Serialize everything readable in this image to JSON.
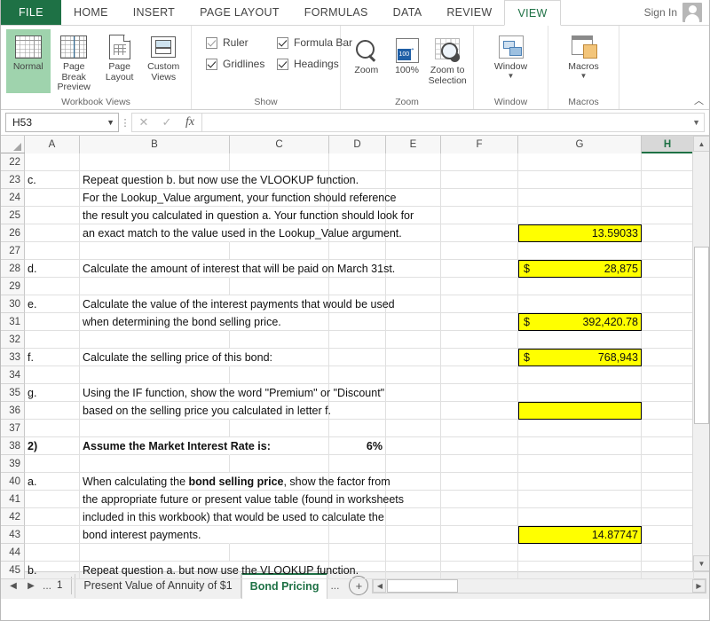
{
  "window": {
    "account": "Sign In",
    "avatar_icon": "user-avatar-icon"
  },
  "ribbon_tabs": [
    {
      "label": "FILE",
      "active": false,
      "file": true
    },
    {
      "label": "HOME",
      "active": false
    },
    {
      "label": "INSERT",
      "active": false
    },
    {
      "label": "PAGE LAYOUT",
      "active": false
    },
    {
      "label": "FORMULAS",
      "active": false
    },
    {
      "label": "DATA",
      "active": false
    },
    {
      "label": "REVIEW",
      "active": false
    },
    {
      "label": "VIEW",
      "active": true
    }
  ],
  "ribbon": {
    "groups": [
      {
        "label": "Workbook Views",
        "buttons": [
          {
            "label_line1": "Normal",
            "label_line2": "",
            "icon": "normal-view-icon",
            "selected": true
          },
          {
            "label_line1": "Page Break",
            "label_line2": "Preview",
            "icon": "page-break-preview-icon",
            "selected": false
          },
          {
            "label_line1": "Page",
            "label_line2": "Layout",
            "icon": "page-layout-icon",
            "selected": false
          },
          {
            "label_line1": "Custom",
            "label_line2": "Views",
            "icon": "custom-views-icon",
            "selected": false
          }
        ]
      },
      {
        "label": "Show",
        "checkboxes": [
          {
            "label": "Ruler",
            "checked": true,
            "dim": true
          },
          {
            "label": "Formula Bar",
            "checked": true,
            "dim": false
          },
          {
            "label": "Gridlines",
            "checked": true,
            "dim": false
          },
          {
            "label": "Headings",
            "checked": true,
            "dim": false
          }
        ]
      },
      {
        "label": "Zoom",
        "buttons": [
          {
            "label_line1": "Zoom",
            "label_line2": "",
            "icon": "magnifier-icon"
          },
          {
            "label_line1": "100%",
            "label_line2": "",
            "icon": "zoom-100-icon"
          },
          {
            "label_line1": "Zoom to",
            "label_line2": "Selection",
            "icon": "zoom-to-selection-icon"
          }
        ]
      },
      {
        "label": "Window",
        "buttons": [
          {
            "label_line1": "Window",
            "label_line2": "",
            "icon": "window-icon",
            "dropdown": true
          }
        ]
      },
      {
        "label": "Macros",
        "buttons": [
          {
            "label_line1": "Macros",
            "label_line2": "",
            "icon": "macros-icon",
            "dropdown": true
          }
        ]
      }
    ],
    "collapse_icon": "collapse-ribbon-icon"
  },
  "formula_bar": {
    "name_box_value": "H53",
    "cancel_icon": "cancel-icon",
    "enter_icon": "confirm-icon",
    "function_icon": "fx-icon",
    "formula_value": "",
    "expand_icon": "expand-formula-bar-icon"
  },
  "grid": {
    "columns": [
      {
        "label": "A",
        "width": 62,
        "selected": false
      },
      {
        "label": "B",
        "width": 169,
        "selected": false
      },
      {
        "label": "C",
        "width": 112,
        "selected": false
      },
      {
        "label": "D",
        "width": 64,
        "selected": false
      },
      {
        "label": "E",
        "width": 62,
        "selected": false
      },
      {
        "label": "F",
        "width": 87,
        "selected": false
      },
      {
        "label": "G",
        "width": 139,
        "selected": false
      },
      {
        "label": "H",
        "width": 59,
        "selected": true
      }
    ],
    "active_cell": "H53",
    "rows": [
      {
        "num": "22",
        "cells": []
      },
      {
        "num": "23",
        "cells": [
          {
            "col": 0,
            "text": "c."
          },
          {
            "col": 1,
            "text": "Repeat question b. but now use the VLOOKUP function.",
            "spill": true
          }
        ]
      },
      {
        "num": "24",
        "cells": [
          {
            "col": 1,
            "text": "For the Lookup_Value argument, your function should reference",
            "spill": true
          }
        ]
      },
      {
        "num": "25",
        "cells": [
          {
            "col": 1,
            "text": "the result you calculated in question a.   Your function should look for",
            "spill": true
          }
        ]
      },
      {
        "num": "26",
        "cells": [
          {
            "col": 1,
            "text": "an exact match to the value used in the Lookup_Value argument.",
            "spill": true
          },
          {
            "col": 6,
            "text": "13.59033",
            "highlight": true,
            "align": "right"
          }
        ]
      },
      {
        "num": "27",
        "cells": []
      },
      {
        "num": "28",
        "cells": [
          {
            "col": 0,
            "text": "d."
          },
          {
            "col": 1,
            "text": "Calculate the amount of interest that will be paid on March 31st.",
            "spill": true
          },
          {
            "col": 6,
            "text": "28,875",
            "prefix": "$",
            "highlight": true,
            "align": "right"
          }
        ]
      },
      {
        "num": "29",
        "cells": []
      },
      {
        "num": "30",
        "cells": [
          {
            "col": 0,
            "text": "e."
          },
          {
            "col": 1,
            "text": "Calculate the value of the interest payments that would be used",
            "spill": true
          }
        ]
      },
      {
        "num": "31",
        "cells": [
          {
            "col": 1,
            "text": "when determining the bond selling price.",
            "spill": true
          },
          {
            "col": 6,
            "text": "392,420.78",
            "prefix": "$",
            "highlight": true,
            "align": "right"
          }
        ]
      },
      {
        "num": "32",
        "cells": []
      },
      {
        "num": "33",
        "cells": [
          {
            "col": 0,
            "text": "f."
          },
          {
            "col": 1,
            "text": "Calculate the selling price of this bond:",
            "spill": true
          },
          {
            "col": 6,
            "text": "768,943",
            "prefix": "$",
            "highlight": true,
            "align": "right"
          }
        ]
      },
      {
        "num": "34",
        "cells": []
      },
      {
        "num": "35",
        "cells": [
          {
            "col": 0,
            "text": "g."
          },
          {
            "col": 1,
            "text": "Using the IF function, show the word \"Premium\" or \"Discount\"",
            "spill": true
          }
        ]
      },
      {
        "num": "36",
        "cells": [
          {
            "col": 1,
            "text": "based on the selling price you calculated in letter f.",
            "spill": true
          },
          {
            "col": 6,
            "text": "",
            "highlight": true,
            "align": "right"
          }
        ]
      },
      {
        "num": "37",
        "cells": []
      },
      {
        "num": "38",
        "cells": [
          {
            "col": 0,
            "text": "2)",
            "bold": true
          },
          {
            "col": 1,
            "text": "Assume the Market Interest Rate is:",
            "bold": true,
            "spill": true
          },
          {
            "col": 3,
            "text": "6%",
            "bold": true,
            "align": "right"
          }
        ]
      },
      {
        "num": "39",
        "cells": []
      },
      {
        "num": "40",
        "cells": [
          {
            "col": 0,
            "text": "a."
          },
          {
            "col": 1,
            "text": "When calculating the bond selling price, show the factor from",
            "spill": true,
            "rich": [
              {
                "t": "When calculating the ",
                "b": false
              },
              {
                "t": "bond selling price",
                "b": true
              },
              {
                "t": ", show the factor from",
                "b": false
              }
            ]
          }
        ]
      },
      {
        "num": "41",
        "cells": [
          {
            "col": 1,
            "text": "the appropriate future or present value table (found in worksheets",
            "spill": true
          }
        ]
      },
      {
        "num": "42",
        "cells": [
          {
            "col": 1,
            "text": "included in this workbook)  that would be used to calculate the",
            "spill": true
          }
        ]
      },
      {
        "num": "43",
        "cells": [
          {
            "col": 1,
            "text": "bond interest payments.",
            "spill": true
          },
          {
            "col": 6,
            "text": "14.87747",
            "highlight": true,
            "align": "right"
          }
        ]
      },
      {
        "num": "44",
        "cells": []
      },
      {
        "num": "45",
        "cells": [
          {
            "col": 0,
            "text": "b."
          },
          {
            "col": 1,
            "text": "Repeat question a. but now use the VLOOKUP function.",
            "spill": true
          }
        ]
      }
    ]
  },
  "sheet_bar": {
    "first_icon": "nav-first-sheet-icon",
    "prev_icon": "nav-previous-sheet-icon",
    "ellipsis_left": "...",
    "hidden_count": "1",
    "tabs": [
      {
        "label": "Present Value of Annuity of $1",
        "active": false
      },
      {
        "label": "Bond Pricing",
        "active": true
      }
    ],
    "ellipsis_right": "...",
    "add_sheet_icon": "add-sheet-icon",
    "hscroll_left_icon": "hscroll-left-icon",
    "hscroll_right_icon": "hscroll-right-icon"
  },
  "colors": {
    "brand_green": "#1e7145",
    "highlight_yellow": "#ffff00",
    "selected_fill": "#9fd3ad"
  }
}
